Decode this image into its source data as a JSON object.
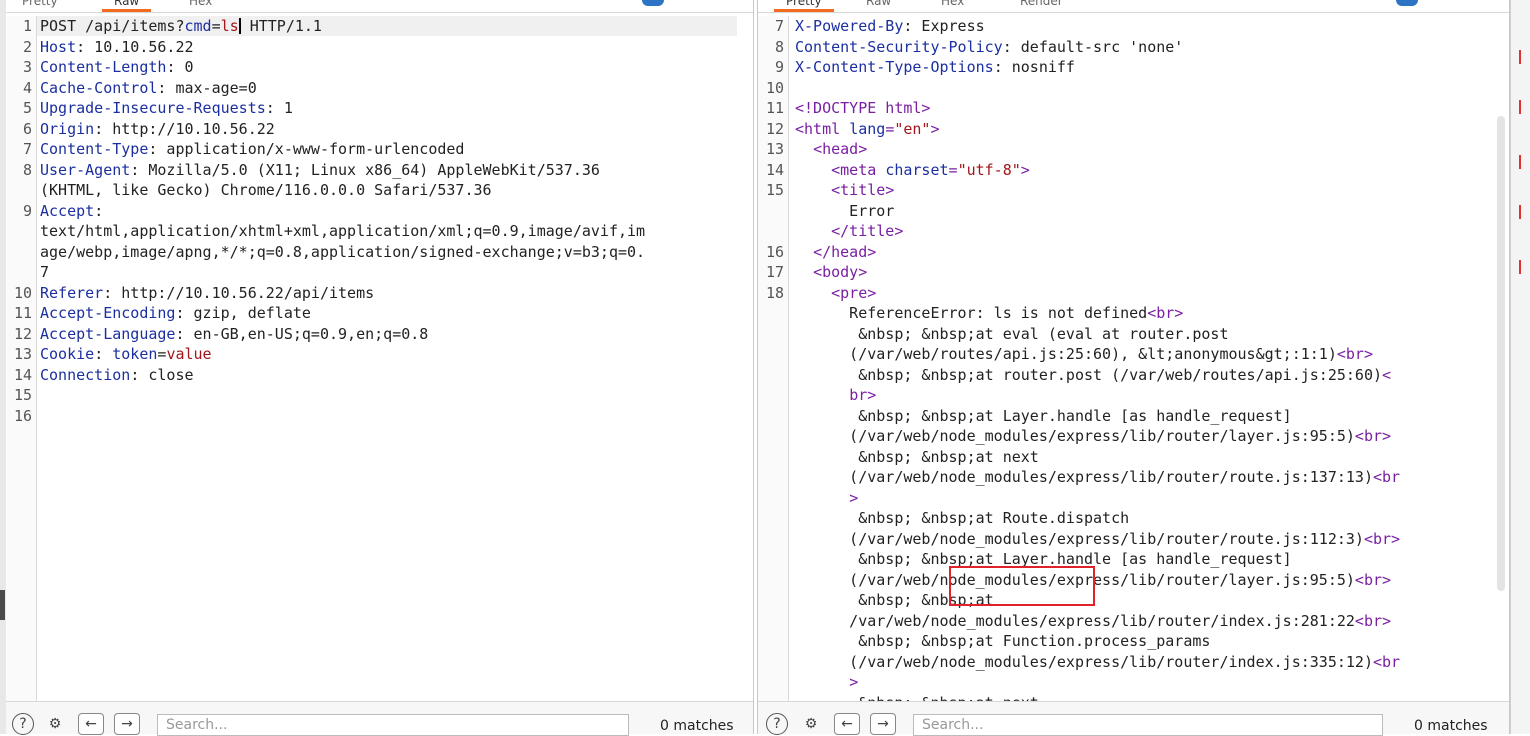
{
  "request": {
    "tabs": [
      "Pretty",
      "Raw",
      "Hex"
    ],
    "lines": [
      {
        "n": "1",
        "parts": [
          [
            "v",
            "POST /api/items?"
          ],
          [
            "k",
            "cmd"
          ],
          [
            "v",
            "="
          ],
          [
            "s",
            "ls"
          ],
          [
            "caret",
            ""
          ],
          [
            "v",
            " HTTP/1.1"
          ]
        ]
      },
      {
        "n": "2",
        "parts": [
          [
            "k",
            "Host"
          ],
          [
            "v",
            ": 10.10.56.22"
          ]
        ]
      },
      {
        "n": "3",
        "parts": [
          [
            "k",
            "Content-Length"
          ],
          [
            "v",
            ": 0"
          ]
        ]
      },
      {
        "n": "4",
        "parts": [
          [
            "k",
            "Cache-Control"
          ],
          [
            "v",
            ": max-age=0"
          ]
        ]
      },
      {
        "n": "5",
        "parts": [
          [
            "k",
            "Upgrade-Insecure-Requests"
          ],
          [
            "v",
            ": 1"
          ]
        ]
      },
      {
        "n": "6",
        "parts": [
          [
            "k",
            "Origin"
          ],
          [
            "v",
            ": http://10.10.56.22"
          ]
        ]
      },
      {
        "n": "7",
        "parts": [
          [
            "k",
            "Content-Type"
          ],
          [
            "v",
            ": application/x-www-form-urlencoded"
          ]
        ]
      },
      {
        "n": "8",
        "parts": [
          [
            "k",
            "User-Agent"
          ],
          [
            "v",
            ": Mozilla/5.0 (X11; Linux x86_64) AppleWebKit/537.36"
          ]
        ]
      },
      {
        "n": "",
        "parts": [
          [
            "v",
            "(KHTML, like Gecko) Chrome/116.0.0.0 Safari/537.36"
          ]
        ]
      },
      {
        "n": "9",
        "parts": [
          [
            "k",
            "Accept"
          ],
          [
            "v",
            ":"
          ]
        ]
      },
      {
        "n": "",
        "parts": [
          [
            "v",
            "text/html,application/xhtml+xml,application/xml;q=0.9,image/avif,im"
          ]
        ]
      },
      {
        "n": "",
        "parts": [
          [
            "v",
            "age/webp,image/apng,*/*;q=0.8,application/signed-exchange;v=b3;q=0."
          ]
        ]
      },
      {
        "n": "",
        "parts": [
          [
            "v",
            "7"
          ]
        ]
      },
      {
        "n": "10",
        "parts": [
          [
            "k",
            "Referer"
          ],
          [
            "v",
            ": http://10.10.56.22/api/items"
          ]
        ]
      },
      {
        "n": "11",
        "parts": [
          [
            "k",
            "Accept-Encoding"
          ],
          [
            "v",
            ": gzip, deflate"
          ]
        ]
      },
      {
        "n": "12",
        "parts": [
          [
            "k",
            "Accept-Language"
          ],
          [
            "v",
            ": en-GB,en-US;q=0.9,en;q=0.8"
          ]
        ]
      },
      {
        "n": "13",
        "parts": [
          [
            "k",
            "Cookie"
          ],
          [
            "v",
            ": "
          ],
          [
            "k",
            "token"
          ],
          [
            "v",
            "="
          ],
          [
            "s",
            "value"
          ]
        ]
      },
      {
        "n": "14",
        "parts": [
          [
            "k",
            "Connection"
          ],
          [
            "v",
            ": close"
          ]
        ]
      },
      {
        "n": "15",
        "parts": []
      },
      {
        "n": "16",
        "parts": []
      }
    ],
    "search_placeholder": "Search...",
    "matches": "0 matches"
  },
  "response": {
    "tabs": [
      "Pretty",
      "Raw",
      "Hex",
      "Render"
    ],
    "lines": [
      {
        "n": "7",
        "parts": [
          [
            "k",
            "X-Powered-By"
          ],
          [
            "v",
            ": Express"
          ]
        ]
      },
      {
        "n": "8",
        "parts": [
          [
            "k",
            "Content-Security-Policy"
          ],
          [
            "v",
            ": default-src 'none'"
          ]
        ]
      },
      {
        "n": "9",
        "parts": [
          [
            "k",
            "X-Content-Type-Options"
          ],
          [
            "v",
            ": nosniff"
          ]
        ]
      },
      {
        "n": "10",
        "parts": []
      },
      {
        "n": "11",
        "parts": [
          [
            "t",
            "<!DOCTYPE html>"
          ]
        ]
      },
      {
        "n": "12",
        "parts": [
          [
            "t",
            "<html "
          ],
          [
            "a",
            "lang"
          ],
          [
            "t",
            "="
          ],
          [
            "s",
            "\"en\""
          ],
          [
            "t",
            ">"
          ]
        ]
      },
      {
        "n": "13",
        "parts": [
          [
            "v",
            "  "
          ],
          [
            "t",
            "<head>"
          ]
        ]
      },
      {
        "n": "14",
        "parts": [
          [
            "v",
            "    "
          ],
          [
            "t",
            "<meta "
          ],
          [
            "a",
            "charset"
          ],
          [
            "t",
            "="
          ],
          [
            "s",
            "\"utf-8\""
          ],
          [
            "t",
            ">"
          ]
        ]
      },
      {
        "n": "15",
        "parts": [
          [
            "v",
            "    "
          ],
          [
            "t",
            "<title>"
          ]
        ]
      },
      {
        "n": "",
        "parts": [
          [
            "v",
            "      Error"
          ]
        ]
      },
      {
        "n": "",
        "parts": [
          [
            "v",
            "    "
          ],
          [
            "t",
            "</title>"
          ]
        ]
      },
      {
        "n": "16",
        "parts": [
          [
            "v",
            "  "
          ],
          [
            "t",
            "</head>"
          ]
        ]
      },
      {
        "n": "17",
        "parts": [
          [
            "v",
            "  "
          ],
          [
            "t",
            "<body>"
          ]
        ]
      },
      {
        "n": "18",
        "parts": [
          [
            "v",
            "    "
          ],
          [
            "t",
            "<pre>"
          ]
        ]
      },
      {
        "n": "",
        "parts": [
          [
            "v",
            "      ReferenceError: ls is not defined"
          ],
          [
            "t",
            "<br>"
          ]
        ]
      },
      {
        "n": "",
        "parts": [
          [
            "v",
            "       &nbsp; &nbsp;at eval (eval at router.post"
          ]
        ]
      },
      {
        "n": "",
        "parts": [
          [
            "v",
            "      (/var/web/routes/api.js:25:60), &lt;anonymous&gt;:1:1)"
          ],
          [
            "t",
            "<br>"
          ]
        ]
      },
      {
        "n": "",
        "parts": [
          [
            "v",
            "       &nbsp; &nbsp;at router.post (/var/web/routes/api.js:25:60)"
          ],
          [
            "t",
            "<"
          ]
        ]
      },
      {
        "n": "",
        "parts": [
          [
            "v",
            "      "
          ],
          [
            "t",
            "br>"
          ]
        ]
      },
      {
        "n": "",
        "parts": [
          [
            "v",
            "       &nbsp; &nbsp;at Layer.handle [as handle_request]"
          ]
        ]
      },
      {
        "n": "",
        "parts": [
          [
            "v",
            "      (/var/web/node_modules/express/lib/router/layer.js:95:5)"
          ],
          [
            "t",
            "<br>"
          ]
        ]
      },
      {
        "n": "",
        "parts": [
          [
            "v",
            "       &nbsp; &nbsp;at next"
          ]
        ]
      },
      {
        "n": "",
        "parts": [
          [
            "v",
            "      (/var/web/node_modules/express/lib/router/route.js:137:13)"
          ],
          [
            "t",
            "<br"
          ]
        ]
      },
      {
        "n": "",
        "parts": [
          [
            "v",
            "      "
          ],
          [
            "t",
            ">"
          ]
        ]
      },
      {
        "n": "",
        "parts": [
          [
            "v",
            "       &nbsp; &nbsp;at Route.dispatch"
          ]
        ]
      },
      {
        "n": "",
        "parts": [
          [
            "v",
            "      (/var/web/node_modules/express/lib/router/route.js:112:3)"
          ],
          [
            "t",
            "<br>"
          ]
        ]
      },
      {
        "n": "",
        "parts": [
          [
            "v",
            "       &nbsp; &nbsp;at Layer.handle [as handle_request]"
          ]
        ]
      },
      {
        "n": "",
        "parts": [
          [
            "v",
            "      (/var/web/node_modules/express/lib/router/layer.js:95:5)"
          ],
          [
            "t",
            "<br>"
          ]
        ]
      },
      {
        "n": "",
        "parts": [
          [
            "v",
            "       &nbsp; &nbsp;at"
          ]
        ]
      },
      {
        "n": "",
        "parts": [
          [
            "v",
            "      /var/web/node_modules/express/lib/router/index.js:281:22"
          ],
          [
            "t",
            "<br>"
          ]
        ]
      },
      {
        "n": "",
        "parts": [
          [
            "v",
            "       &nbsp; &nbsp;at Function.process_params"
          ]
        ]
      },
      {
        "n": "",
        "parts": [
          [
            "v",
            "      (/var/web/node_modules/express/lib/router/index.js:335:12)"
          ],
          [
            "t",
            "<br"
          ]
        ]
      },
      {
        "n": "",
        "parts": [
          [
            "v",
            "      "
          ],
          [
            "t",
            ">"
          ]
        ]
      },
      {
        "n": "",
        "parts": [
          [
            "v",
            "       &nbsp; &nbsp;at next"
          ]
        ]
      }
    ],
    "search_placeholder": "Search...",
    "matches": "0 matches"
  },
  "icons": {
    "help": "help-icon",
    "settings": "gear-icon",
    "prev": "arrow-left-icon",
    "next": "arrow-right-icon"
  },
  "colors": {
    "key": "#1c2fa0",
    "tag": "#7a1fa2",
    "string": "#a3151a",
    "accent": "#f26b21",
    "highlight_box": "#e0232b"
  }
}
